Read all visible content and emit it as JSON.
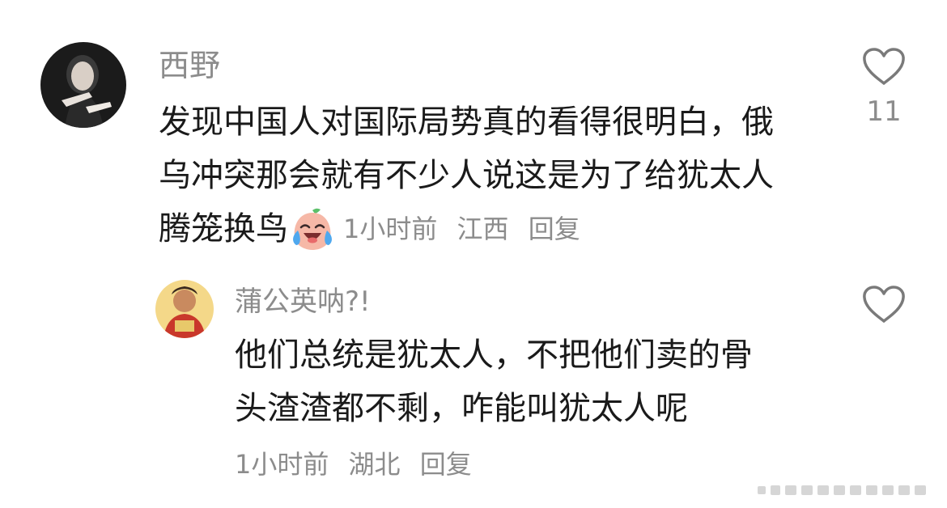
{
  "comments": [
    {
      "username": "西野",
      "lines": [
        "发现中国人对国际局势真的看得很明白，俄",
        "乌冲突那会就有不少人说这是为了给犹太人",
        "腾笼换鸟"
      ],
      "emoji": "crying-laughing-peach-emoji",
      "time": "1小时前",
      "location": "江西",
      "reply_label": "回复",
      "like_count": "11"
    }
  ],
  "replies": [
    {
      "username": "蒲公英呐?!",
      "lines": [
        "他们总统是犹太人，不把他们卖的骨",
        "头渣渣都不剩，咋能叫犹太人呢"
      ],
      "time": "1小时前",
      "location": "湖北",
      "reply_label": "回复",
      "like_count": ""
    }
  ],
  "colors": {
    "text": "#1a1a1a",
    "muted": "#8c8c8c",
    "heart_stroke": "#7a7a7a"
  },
  "icons": [
    "heart-outline-icon",
    "watermark-icon"
  ]
}
